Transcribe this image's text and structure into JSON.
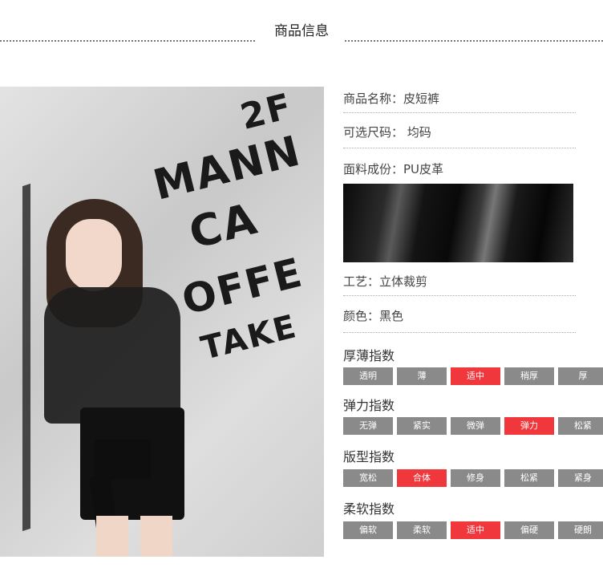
{
  "header": {
    "title": "商品信息"
  },
  "photo": {
    "sign_lines": [
      "2F",
      "MANN",
      "CA",
      "OFFE",
      "TAKE"
    ]
  },
  "info": {
    "name": "商品名称：皮短裤",
    "size": "可选尺码： 均码",
    "material": "面料成份：PU皮革",
    "craft": "工艺：立体裁剪",
    "color": "颜色：黑色"
  },
  "indexes": [
    {
      "title": "厚薄指数",
      "options": [
        "透明",
        "薄",
        "适中",
        "稍厚",
        "厚"
      ],
      "selected": 2
    },
    {
      "title": "弹力指数",
      "options": [
        "无弹",
        "紧实",
        "微弹",
        "弹力",
        "松紧"
      ],
      "selected": 3
    },
    {
      "title": "版型指数",
      "options": [
        "宽松",
        "合体",
        "修身",
        "松紧",
        "紧身"
      ],
      "selected": 1
    },
    {
      "title": "柔软指数",
      "options": [
        "偏软",
        "柔软",
        "适中",
        "偏硬",
        "硬朗"
      ],
      "selected": 2
    }
  ],
  "colors": {
    "active": "#f0373c",
    "inactive": "#8a8a8a"
  }
}
